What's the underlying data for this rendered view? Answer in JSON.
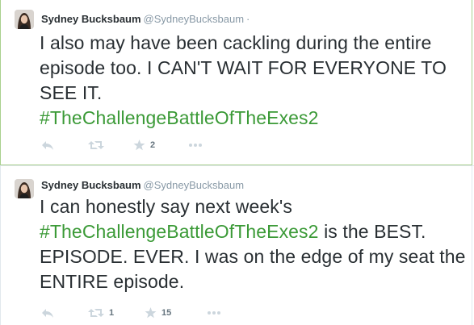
{
  "tweets": [
    {
      "author_name": "Sydney Bucksbaum",
      "author_handle": "@SydneyBucksbaum",
      "separator": "·",
      "text_before": "I also may have been cackling during the entire episode too. I CAN'T WAIT FOR EVERYONE TO SEE IT.",
      "hashtag": "#TheChallengeBattleOfTheExes2",
      "text_after": "",
      "retweet_count": "",
      "favorite_count": "2"
    },
    {
      "author_name": "Sydney Bucksbaum",
      "author_handle": "@SydneyBucksbaum",
      "text_before": "I can honestly say next week's",
      "hashtag": "#TheChallengeBattleOfTheExes2",
      "text_after": "is the BEST. EPISODE. EVER. I was on the edge of my seat the ENTIRE episode.",
      "retweet_count": "1",
      "favorite_count": "15"
    }
  ],
  "icons": {
    "reply": "reply-icon",
    "retweet": "retweet-icon",
    "favorite": "star-icon",
    "more": "more-icon",
    "avatar": "avatar"
  },
  "colors": {
    "hashtag": "#3b9a37",
    "highlight_border": "#a9d08e",
    "action_gray": "#ccd6dd"
  }
}
